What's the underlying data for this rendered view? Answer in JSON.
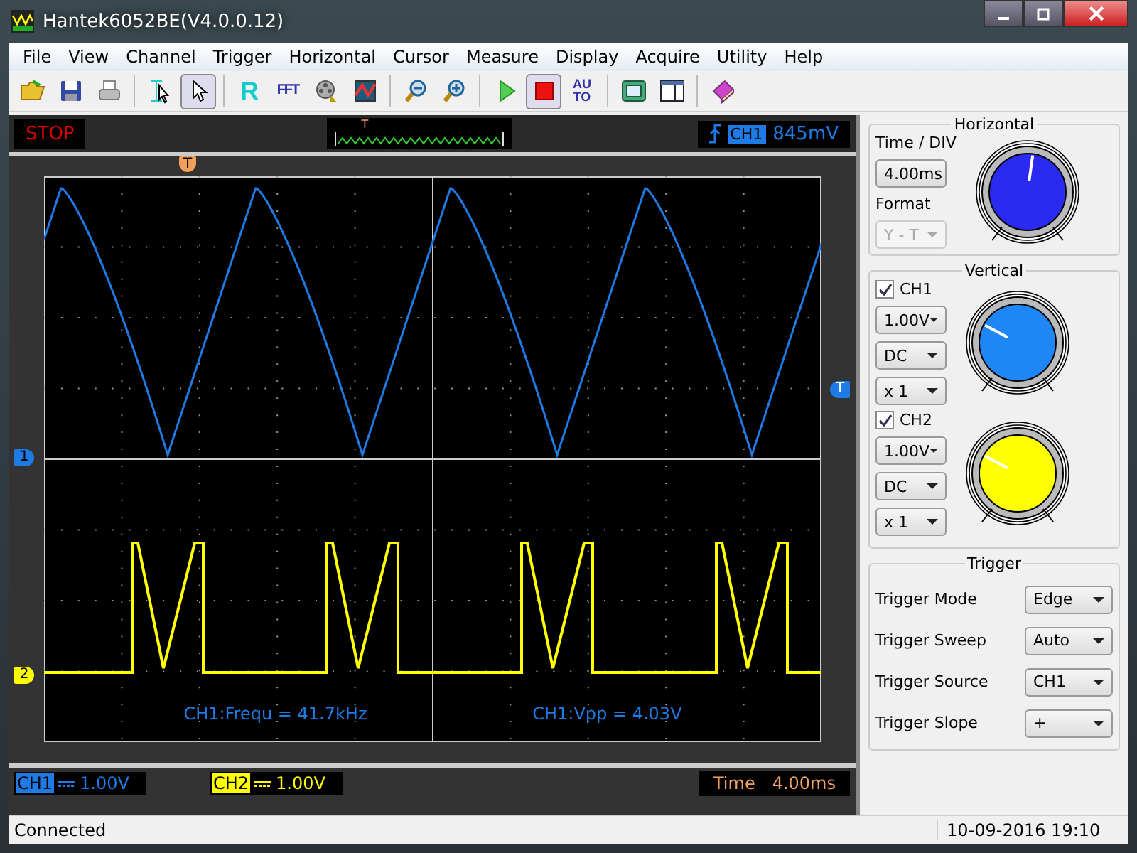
{
  "window": {
    "title": "Hantek6052BE(V4.0.0.12)"
  },
  "menu": [
    "File",
    "View",
    "Channel",
    "Trigger",
    "Horizontal",
    "Cursor",
    "Measure",
    "Display",
    "Acquire",
    "Utility",
    "Help"
  ],
  "toolbar": [
    {
      "kind": "open",
      "pressed": false
    },
    {
      "kind": "save",
      "pressed": false
    },
    {
      "kind": "print",
      "pressed": false
    },
    {
      "kind": "separator"
    },
    {
      "kind": "cursor-select",
      "pressed": false
    },
    {
      "kind": "pointer",
      "pressed": true
    },
    {
      "kind": "separator"
    },
    {
      "kind": "text",
      "label": "R",
      "pressed": false
    },
    {
      "kind": "text",
      "label": "FFT",
      "pressed": false
    },
    {
      "kind": "reel",
      "pressed": false
    },
    {
      "kind": "wave-screen",
      "pressed": false
    },
    {
      "kind": "separator"
    },
    {
      "kind": "zoom-out",
      "pressed": false
    },
    {
      "kind": "zoom-in",
      "pressed": false
    },
    {
      "kind": "separator"
    },
    {
      "kind": "run",
      "pressed": false
    },
    {
      "kind": "stop",
      "pressed": true
    },
    {
      "kind": "text",
      "label": "AU TO",
      "pressed": false
    },
    {
      "kind": "separator"
    },
    {
      "kind": "fit",
      "pressed": false
    },
    {
      "kind": "panel",
      "pressed": false
    },
    {
      "kind": "separator"
    },
    {
      "kind": "book",
      "pressed": false
    }
  ],
  "scope": {
    "run_state": "STOP",
    "memory_trigger_marker": "T",
    "trigger_position_marker": "T",
    "trigger_readout": {
      "channel": "CH1",
      "value": "845mV"
    },
    "trigger_level_marker": "T",
    "measurements": [
      "CH1:Frequ = 41.7kHz",
      "CH1:Vpp = 4.03V"
    ],
    "channels": [
      {
        "name": "CH1",
        "marker": "1",
        "value": "1.00V",
        "color": "#1e7be6"
      },
      {
        "name": "CH2",
        "marker": "2",
        "value": "1.00V",
        "color": "#ffff00"
      }
    ],
    "time": {
      "label": "Time",
      "value": "4.00ms"
    }
  },
  "horizontal": {
    "title": "Horizontal",
    "time_div_label": "Time / DIV",
    "time_div": "4.00ms",
    "format_label": "Format",
    "format": "Y - T",
    "format_disabled": true
  },
  "vertical": {
    "title": "Vertical",
    "channels": [
      {
        "name": "CH1",
        "checked": true,
        "volts": "1.00V",
        "coupling": "DC",
        "probe": "x 1"
      },
      {
        "name": "CH2",
        "checked": true,
        "volts": "1.00V",
        "coupling": "DC",
        "probe": "x 1"
      }
    ]
  },
  "trigger": {
    "title": "Trigger",
    "rows": [
      {
        "label": "Trigger Mode",
        "value": "Edge"
      },
      {
        "label": "Trigger Sweep",
        "value": "Auto"
      },
      {
        "label": "Trigger Source",
        "value": "CH1"
      },
      {
        "label": "Trigger Slope",
        "value": "+"
      }
    ]
  },
  "status_bar": {
    "message": "Connected",
    "datetime": "10-09-2016  19:10"
  }
}
